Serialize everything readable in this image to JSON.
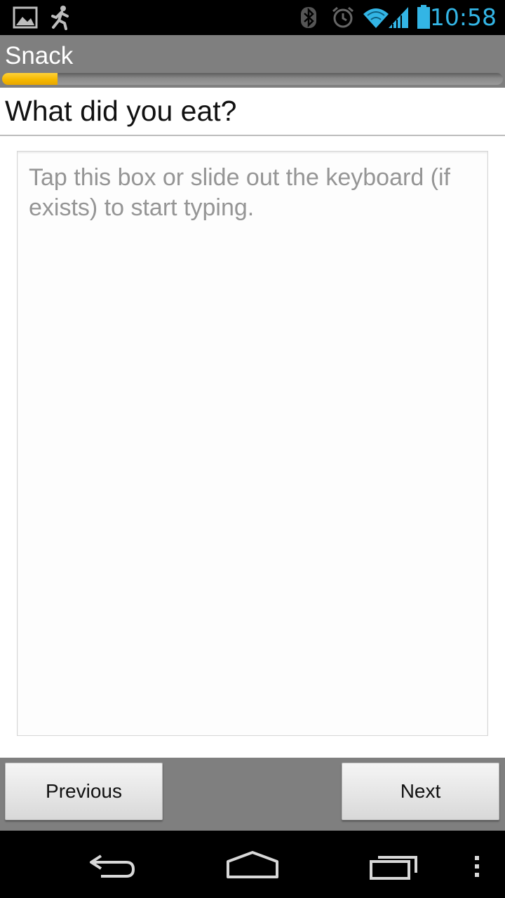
{
  "status_bar": {
    "time": "10:58",
    "icons": [
      "gallery-icon",
      "running-man-icon",
      "bluetooth-icon",
      "alarm-icon",
      "wifi-icon",
      "signal-icon",
      "battery-icon"
    ],
    "accent_color": "#33b5e5"
  },
  "action_bar": {
    "title": "Snack",
    "progress_fraction": 0.11,
    "progress_color": "#f5b800"
  },
  "question": {
    "text": "What did you eat?"
  },
  "answer": {
    "value": "",
    "placeholder": "Tap this box or slide out the keyboard (if exists) to start typing."
  },
  "buttons": {
    "previous": "Previous",
    "next": "Next"
  },
  "nav_bar": {
    "icons": [
      "back-icon",
      "home-icon",
      "recent-apps-icon",
      "overflow-menu-icon"
    ]
  }
}
